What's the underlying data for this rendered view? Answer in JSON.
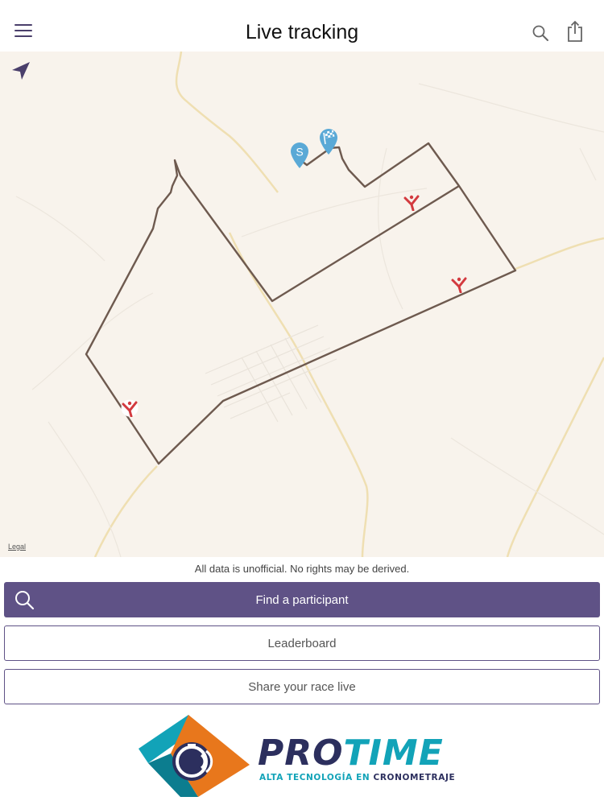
{
  "header": {
    "title": "Live tracking",
    "menu_icon": "hamburger-menu-icon",
    "search_icon": "search-icon",
    "share_icon": "share-icon"
  },
  "map": {
    "legal_label": "Legal",
    "locate_icon": "location-arrow-icon",
    "start_pin_label": "S",
    "finish_pin_icon": "checkered-flag-icon",
    "route_color": "#6e5a4f",
    "pin_color": "#5aa9d6",
    "aid_station_icon": "protime-runner-icon",
    "aid_station_color": "#d33a3f"
  },
  "disclaimer": "All data is unofficial. No rights may be derived.",
  "actions": {
    "find_participant": "Find a participant",
    "leaderboard": "Leaderboard",
    "share_race": "Share your race live"
  },
  "brand": {
    "name_part1": "PRO",
    "name_part2": "TIME",
    "tagline_part1": "ALTA TECNOLOGÍA EN",
    "tagline_part2": "CRONOMETRAJE",
    "primary_color": "#5f5286",
    "accent_color": "#12a3b8",
    "dark_color": "#2c2f5e"
  }
}
